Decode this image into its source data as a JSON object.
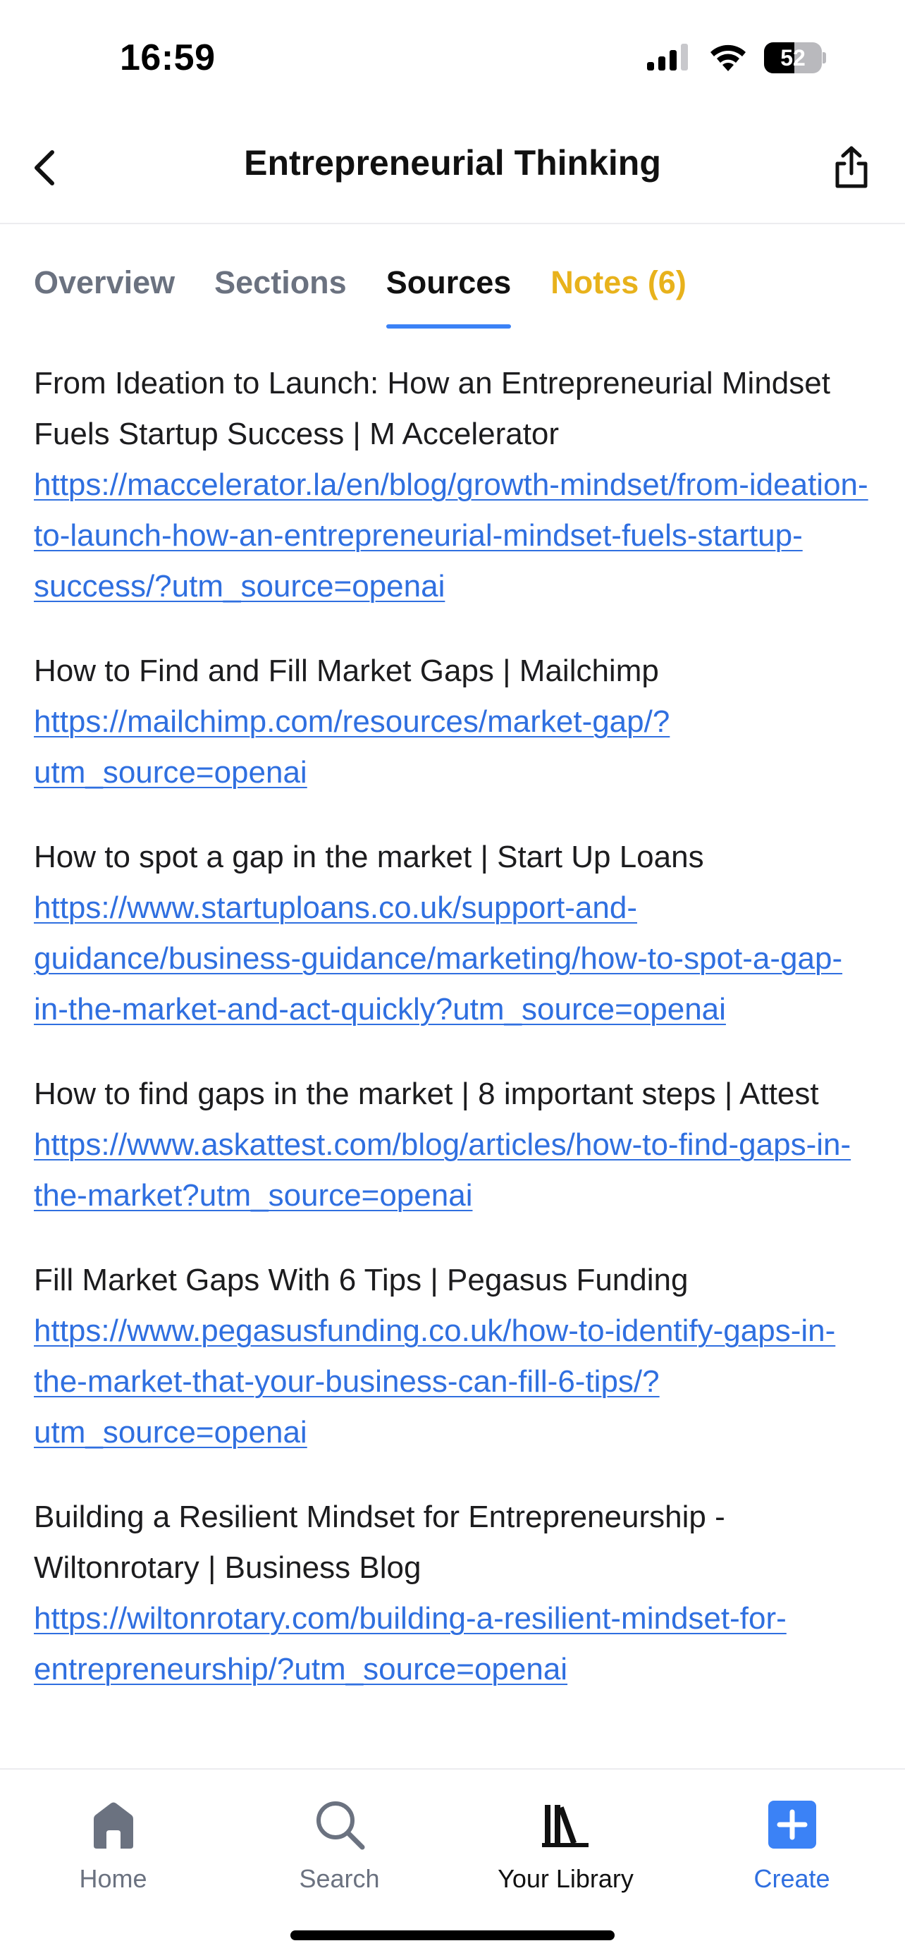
{
  "status_bar": {
    "time": "16:59",
    "battery": "52",
    "battery_level": 0.52
  },
  "header": {
    "title": "Entrepreneurial Thinking",
    "back_icon": "chevron-left-icon",
    "share_icon": "share-icon"
  },
  "tabs": [
    {
      "label": "Overview"
    },
    {
      "label": "Sections"
    },
    {
      "label": "Sources"
    },
    {
      "label": "Notes (6)"
    }
  ],
  "sources": [
    {
      "title": "From Ideation to Launch: How an Entrepreneurial Mindset Fuels Startup Success | M Accelerator",
      "url": "https://maccelerator.la/en/blog/growth-mindset/from-ideation-to-launch-how-an-entrepreneurial-mindset-fuels-startup-success/?utm_source=openai"
    },
    {
      "title": "How to Find and Fill Market Gaps | Mailchimp",
      "url": "https://mailchimp.com/resources/market-gap/?utm_source=openai"
    },
    {
      "title": "How to spot a gap in the market | Start Up Loans",
      "url": "https://www.startuploans.co.uk/support-and-guidance/business-guidance/marketing/how-to-spot-a-gap-in-the-market-and-act-quickly?utm_source=openai"
    },
    {
      "title": "How to find gaps in the market | 8 important steps | Attest",
      "url": "https://www.askattest.com/blog/articles/how-to-find-gaps-in-the-market?utm_source=openai"
    },
    {
      "title": "Fill Market Gaps With 6 Tips | Pegasus Funding",
      "url": "https://www.pegasusfunding.co.uk/how-to-identify-gaps-in-the-market-that-your-business-can-fill-6-tips/?utm_source=openai"
    },
    {
      "title": "Building a Resilient Mindset for Entrepreneurship - Wiltonrotary | Business Blog",
      "url": "https://wiltonrotary.com/building-a-resilient-mindset-for-entrepreneurship/?utm_source=openai"
    }
  ],
  "tab_bar": [
    {
      "label": "Home",
      "icon": "home-icon"
    },
    {
      "label": "Search",
      "icon": "search-icon"
    },
    {
      "label": "Your Library",
      "icon": "library-icon"
    },
    {
      "label": "Create",
      "icon": "plus-square-icon"
    }
  ],
  "colors": {
    "accent": "#3b82f6",
    "link": "#2f6fe0",
    "notes_tab": "#e8b21c",
    "inactive_text": "#6b7280"
  }
}
